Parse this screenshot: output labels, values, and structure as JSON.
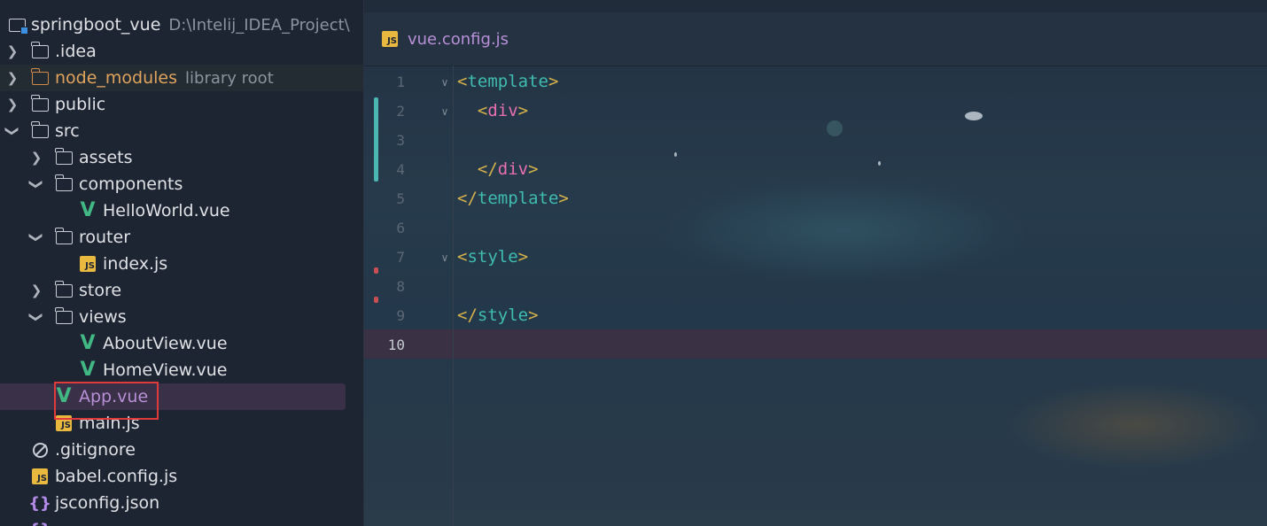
{
  "project": {
    "name": "springboot_vue",
    "path": "D:\\Intelij_IDEA_Project\\"
  },
  "tree": [
    {
      "label": "springboot_vue",
      "extra": "D:\\Intelij_IDEA_Project\\",
      "icon": "root-folder-icon"
    },
    {
      "label": ".idea",
      "icon": "folder-icon",
      "expanded": false
    },
    {
      "label": "node_modules",
      "extra": "library root",
      "icon": "folder-icon",
      "expanded": false
    },
    {
      "label": "public",
      "icon": "folder-icon",
      "expanded": false
    },
    {
      "label": "src",
      "icon": "folder-icon",
      "expanded": true
    },
    {
      "label": "assets",
      "icon": "folder-icon",
      "expanded": false
    },
    {
      "label": "components",
      "icon": "folder-icon",
      "expanded": true
    },
    {
      "label": "HelloWorld.vue",
      "icon": "vue-icon"
    },
    {
      "label": "router",
      "icon": "folder-icon",
      "expanded": true
    },
    {
      "label": "index.js",
      "icon": "js-icon"
    },
    {
      "label": "store",
      "icon": "folder-icon",
      "expanded": false
    },
    {
      "label": "views",
      "icon": "folder-icon",
      "expanded": true
    },
    {
      "label": "AboutView.vue",
      "icon": "vue-icon"
    },
    {
      "label": "HomeView.vue",
      "icon": "vue-icon"
    },
    {
      "label": "App.vue",
      "icon": "vue-icon",
      "selected": true
    },
    {
      "label": "main.js",
      "icon": "js-icon"
    },
    {
      "label": ".gitignore",
      "icon": "gitignore-icon"
    },
    {
      "label": "babel.config.js",
      "icon": "js-icon"
    },
    {
      "label": "jsconfig.json",
      "icon": "json-icon"
    }
  ],
  "editor": {
    "tab": {
      "label": "vue.config.js",
      "icon": "js-icon",
      "icon_text": "JS"
    },
    "line_numbers": [
      "1",
      "2",
      "3",
      "4",
      "5",
      "6",
      "7",
      "8",
      "9",
      "10"
    ],
    "current_line": "10",
    "code": [
      {
        "open": "<",
        "tag": "template",
        "close": ">"
      },
      {
        "indent": "  ",
        "open": "<",
        "tag": "div",
        "close": ">"
      },
      {},
      {
        "indent": "  ",
        "open": "</",
        "tag": "div",
        "close": ">"
      },
      {
        "open": "</",
        "tag": "template",
        "close": ">"
      },
      {},
      {
        "open": "<",
        "tag": "style",
        "close": ">"
      },
      {},
      {
        "open": "</",
        "tag": "style",
        "close": ">"
      },
      {}
    ]
  },
  "colors": {
    "selection": "#3a3047",
    "accent_red": "#e03a3a",
    "vue_green": "#41b883",
    "js_yellow": "#e8b83f"
  }
}
